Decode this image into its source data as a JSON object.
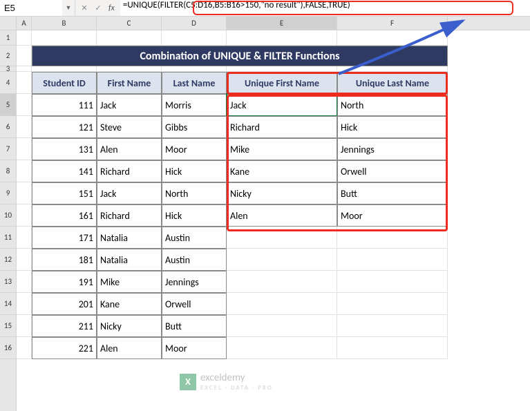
{
  "nameBox": "E5",
  "formula": "=UNIQUE(FILTER(C5:D16,B5:B16>150,\"no result\"),FALSE,TRUE)",
  "title": "Combination of UNIQUE & FILTER Functions",
  "columns": [
    "A",
    "B",
    "C",
    "D",
    "E",
    "F"
  ],
  "rowNums": [
    "1",
    "2",
    "3",
    "4",
    "5",
    "6",
    "7",
    "8",
    "9",
    "10",
    "11",
    "12",
    "13",
    "14",
    "15",
    "16"
  ],
  "headers": {
    "b": "Student ID",
    "c": "First Name",
    "d": "Last Name",
    "e": "Unique First Name",
    "f": "Unique Last Name"
  },
  "rows": [
    {
      "id": "111",
      "first": "Jack",
      "last": "Morris",
      "uf": "Jack",
      "ul": "North"
    },
    {
      "id": "121",
      "first": "Steve",
      "last": "Gibbs",
      "uf": "Richard",
      "ul": "Hick"
    },
    {
      "id": "131",
      "first": "Alen",
      "last": "Moor",
      "uf": "Mike",
      "ul": "Jennings"
    },
    {
      "id": "141",
      "first": "Richard",
      "last": "Hick",
      "uf": "Kane",
      "ul": "Orwell"
    },
    {
      "id": "151",
      "first": "Jack",
      "last": "North",
      "uf": "Nicky",
      "ul": "Butt"
    },
    {
      "id": "161",
      "first": "Richard",
      "last": "Hick",
      "uf": "Alen",
      "ul": "Moor"
    },
    {
      "id": "171",
      "first": "Natalia",
      "last": "Austin",
      "uf": "",
      "ul": ""
    },
    {
      "id": "181",
      "first": "Natalia",
      "last": "Austin",
      "uf": "",
      "ul": ""
    },
    {
      "id": "191",
      "first": "Mike",
      "last": "Jennings",
      "uf": "",
      "ul": ""
    },
    {
      "id": "201",
      "first": "Kane",
      "last": "Orwell",
      "uf": "",
      "ul": ""
    },
    {
      "id": "211",
      "first": "Nicky",
      "last": "Butt",
      "uf": "",
      "ul": ""
    },
    {
      "id": "221",
      "first": "Alen",
      "last": "Moor",
      "uf": "",
      "ul": ""
    }
  ],
  "watermark": {
    "brand": "exceldemy",
    "tag": "EXCEL · DATA · PRO"
  }
}
